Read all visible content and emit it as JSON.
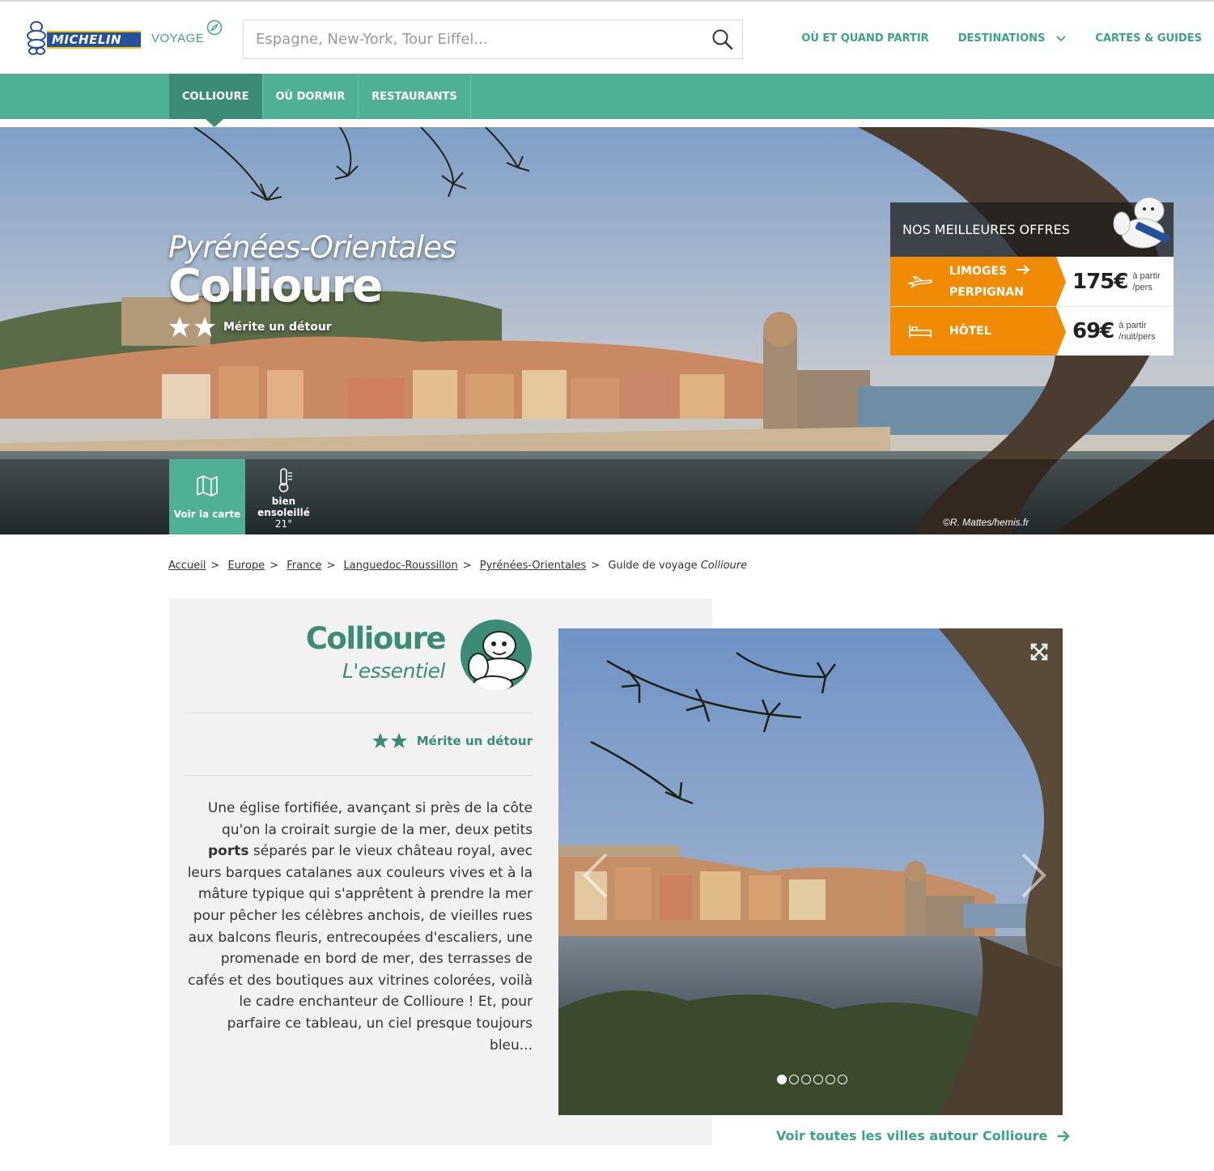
{
  "header": {
    "brand": "MICHELIN",
    "brand_sub": "VOYAGE",
    "search_placeholder": "Espagne, New-York, Tour Eiffel...",
    "nav": [
      "OÙ ET QUAND PARTIR",
      "DESTINATIONS",
      "CARTES & GUIDES"
    ]
  },
  "subnav": {
    "tabs": [
      "COLLIOURE",
      "OÙ DORMIR",
      "RESTAURANTS"
    ],
    "active": "COLLIOURE"
  },
  "hero": {
    "region": "Pyrénées-Orientales",
    "city": "Collioure",
    "rating_label": "Mérite un détour",
    "rating_stars": 2,
    "map_label": "Voir la carte",
    "weather_label": "bien ensoleillé",
    "weather_temp": "21°",
    "credit": "©R. Mattes/hemis.fr"
  },
  "offers": {
    "title": "NOS MEILLEURES OFFRES",
    "flight": {
      "from": "LIMOGES",
      "to": "PERPIGNAN",
      "price": "175€",
      "unit_line1": "à partir",
      "unit_line2": "/pers"
    },
    "hotel": {
      "label": "HÔTEL",
      "price": "69€",
      "unit_line1": "à partir",
      "unit_line2": "/nuit/pers"
    }
  },
  "breadcrumb": {
    "items": [
      "Accueil",
      "Europe",
      "France",
      "Languedoc-Roussillon",
      "Pyrénées-Orientales"
    ],
    "current_prefix": "Guide de voyage",
    "current_name": "Collioure"
  },
  "essentiel": {
    "city": "Collioure",
    "subtitle": "L'essentiel",
    "rating_label": "Mérite un détour",
    "text_before": "Une église fortifiée, avançant si près de la côte qu'on la croirait surgie de la mer, deux petits ",
    "text_bold": "ports",
    "text_after": " séparés par le vieux château royal, avec leurs barques catalanes aux couleurs vives et à la mâture typique qui s'apprêtent à prendre la mer pour pêcher les célèbres anchois, de vieilles rues aux balcons fleuris, entrecoupées d'escaliers, une promenade en bord de mer, des terrasses de cafés et des boutiques aux vitrines colorées, voilà le cadre enchanteur de Collioure ! Et, pour parfaire ce tableau, un ciel presque toujours bleu..."
  },
  "gallery": {
    "slides": 6,
    "current": 1
  },
  "see_all": "Voir toutes les villes autour Collioure",
  "colors": {
    "brand_green": "#4fb095",
    "dark_green": "#3a8c75",
    "orange": "#f08b05",
    "michelin_blue": "#27509b"
  }
}
